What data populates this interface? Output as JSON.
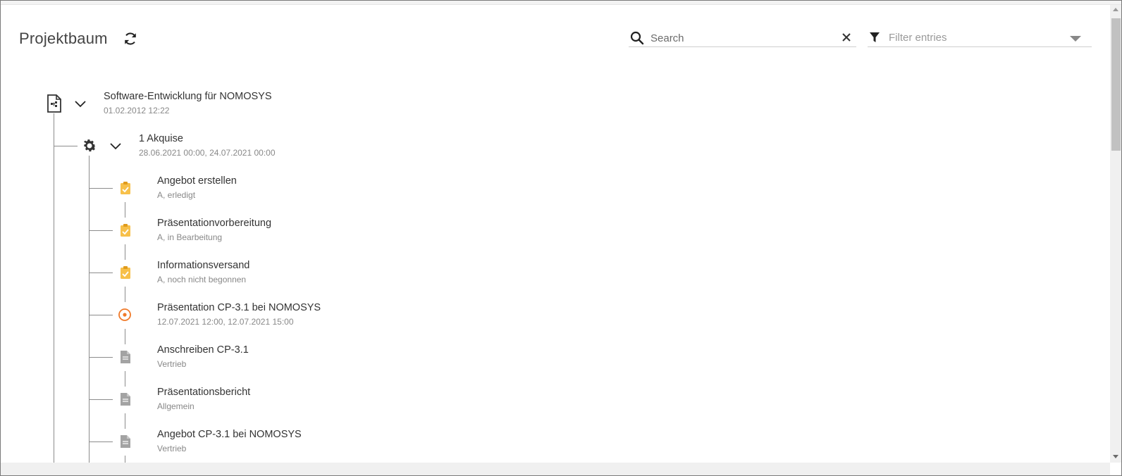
{
  "header": {
    "title": "Projektbaum",
    "search_placeholder": "Search",
    "filter_placeholder": "Filter entries"
  },
  "tree": {
    "root": {
      "label": "Software-Entwicklung für NOMOSYS",
      "sub": "01.02.2012 12:22",
      "icon": "project-icon"
    },
    "phase": {
      "label": "1 Akquise",
      "sub": "28.06.2021 00:00, 24.07.2021 00:00",
      "icon": "gear-icon"
    },
    "items": [
      {
        "label": "Angebot erstellen",
        "sub": "A, erledigt",
        "icon": "clipboard-check-icon"
      },
      {
        "label": "Präsentationvorbereitung",
        "sub": "A, in Bearbeitung",
        "icon": "clipboard-check-icon"
      },
      {
        "label": "Informationsversand",
        "sub": "A, noch nicht begonnen",
        "icon": "clipboard-check-icon"
      },
      {
        "label": "Präsentation CP-3.1 bei NOMOSYS",
        "sub": "12.07.2021 12:00, 12.07.2021 15:00",
        "icon": "event-target-icon"
      },
      {
        "label": "Anschreiben CP-3.1",
        "sub": "Vertrieb",
        "icon": "document-icon"
      },
      {
        "label": "Präsentationsbericht",
        "sub": "Allgemein",
        "icon": "document-icon"
      },
      {
        "label": "Angebot CP-3.1 bei NOMOSYS",
        "sub": "Vertrieb",
        "icon": "document-icon"
      }
    ]
  },
  "colors": {
    "task_icon": "#f5b324",
    "event_icon": "#f07a2a",
    "document_icon": "#9a9a9a",
    "tree_line": "#8c8c8c"
  }
}
